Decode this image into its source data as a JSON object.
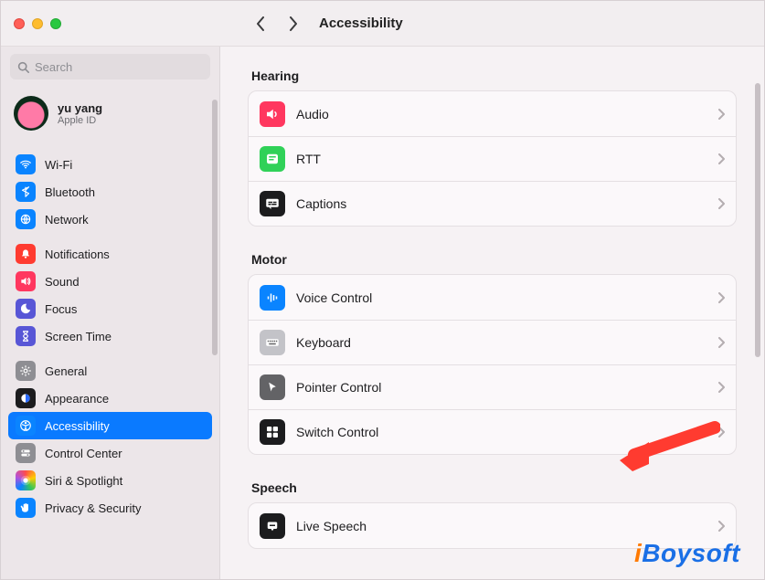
{
  "titlebar": {
    "title": "Accessibility"
  },
  "search": {
    "placeholder": "Search"
  },
  "user": {
    "name": "yu yang",
    "sub": "Apple ID"
  },
  "sidebar": {
    "groups": [
      {
        "items": [
          {
            "id": "wifi",
            "label": "Wi-Fi",
            "icon": "wifi-icon",
            "color": "c-blue"
          },
          {
            "id": "bluetooth",
            "label": "Bluetooth",
            "icon": "bluetooth-icon",
            "color": "c-blue"
          },
          {
            "id": "network",
            "label": "Network",
            "icon": "network-icon",
            "color": "c-blue"
          }
        ]
      },
      {
        "items": [
          {
            "id": "notifications",
            "label": "Notifications",
            "icon": "bell-icon",
            "color": "c-red"
          },
          {
            "id": "sound",
            "label": "Sound",
            "icon": "sound-icon",
            "color": "c-pink"
          },
          {
            "id": "focus",
            "label": "Focus",
            "icon": "moon-icon",
            "color": "c-indigo"
          },
          {
            "id": "screentime",
            "label": "Screen Time",
            "icon": "hourglass-icon",
            "color": "c-indigo"
          }
        ]
      },
      {
        "items": [
          {
            "id": "general",
            "label": "General",
            "icon": "gear-icon",
            "color": "c-gray"
          },
          {
            "id": "appearance",
            "label": "Appearance",
            "icon": "appearance-icon",
            "color": "c-black"
          },
          {
            "id": "accessibility",
            "label": "Accessibility",
            "icon": "accessibility-icon",
            "color": "c-blue",
            "selected": true
          },
          {
            "id": "controlcenter",
            "label": "Control Center",
            "icon": "toggles-icon",
            "color": "c-gray"
          },
          {
            "id": "siri",
            "label": "Siri & Spotlight",
            "icon": "siri-icon",
            "color": "c-multi"
          },
          {
            "id": "privacy",
            "label": "Privacy & Security",
            "icon": "hand-icon",
            "color": "c-blue"
          }
        ]
      }
    ]
  },
  "main": {
    "sections": [
      {
        "title": "Hearing",
        "rows": [
          {
            "id": "audio",
            "label": "Audio",
            "icon": "audio-icon",
            "color": "c-pink"
          },
          {
            "id": "rtt",
            "label": "RTT",
            "icon": "rtt-icon",
            "color": "c-green"
          },
          {
            "id": "captions",
            "label": "Captions",
            "icon": "captions-icon",
            "color": "c-black"
          }
        ]
      },
      {
        "title": "Motor",
        "rows": [
          {
            "id": "voicecontrol",
            "label": "Voice Control",
            "icon": "voice-icon",
            "color": "c-blue"
          },
          {
            "id": "keyboard",
            "label": "Keyboard",
            "icon": "keyboard-icon",
            "color": "c-grayl"
          },
          {
            "id": "pointercontrol",
            "label": "Pointer Control",
            "icon": "pointer-icon",
            "color": "c-darkgr"
          },
          {
            "id": "switchcontrol",
            "label": "Switch Control",
            "icon": "switch-icon",
            "color": "c-black"
          }
        ]
      },
      {
        "title": "Speech",
        "rows": [
          {
            "id": "livespeech",
            "label": "Live Speech",
            "icon": "livespeech-icon",
            "color": "c-black"
          }
        ]
      }
    ]
  },
  "watermark": "iBoysoft"
}
